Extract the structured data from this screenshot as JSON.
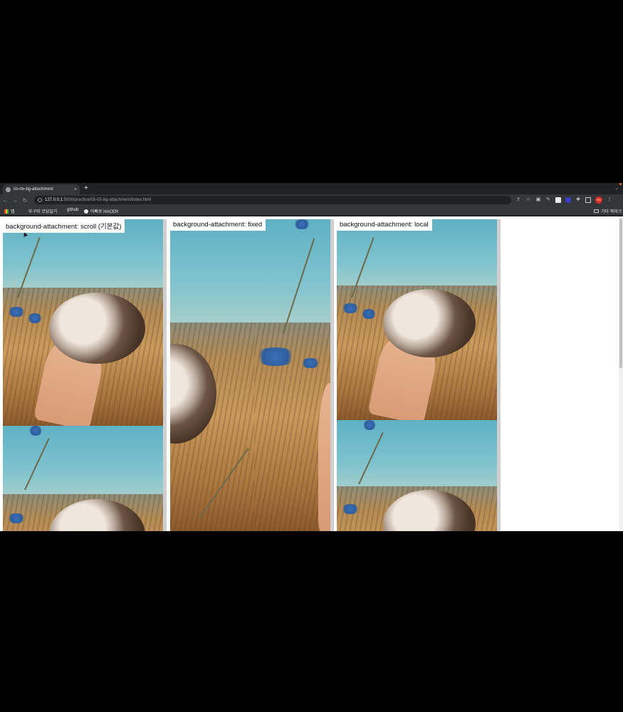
{
  "browser": {
    "tab": {
      "title": "05-05-bg-attachment",
      "close": "×"
    },
    "new_tab": "+",
    "tab_menu": "⌄",
    "nav": {
      "back": "←",
      "forward": "→",
      "reload": "↻"
    },
    "address": {
      "host": "127.0.0.1",
      "path": ":5500/practice/05-05-bg-attachment/index.html"
    },
    "toolbar_icons": [
      "share-icon",
      "star-icon",
      "camera-icon",
      "pen-icon",
      "extension-icon",
      "extension-icon",
      "puzzle-icon",
      "sidepanel-icon"
    ],
    "profile_initials": "SG",
    "menu": "⋮",
    "bookmarks": [
      {
        "label": "앱",
        "icon": "apps-grid-icon"
      },
      {
        "label": "뚜구미 코딩일기",
        "icon": "none"
      },
      {
        "label": "github",
        "icon": "none"
      },
      {
        "label": "아빠로 HACER",
        "icon": "globe-icon"
      }
    ],
    "other_bookmarks": "기타 북마크"
  },
  "page": {
    "boxes": [
      {
        "label": "background-attachment: scroll (기본값)"
      },
      {
        "label": "background-attachment: fixed"
      },
      {
        "label": "background-attachment: local"
      }
    ]
  }
}
